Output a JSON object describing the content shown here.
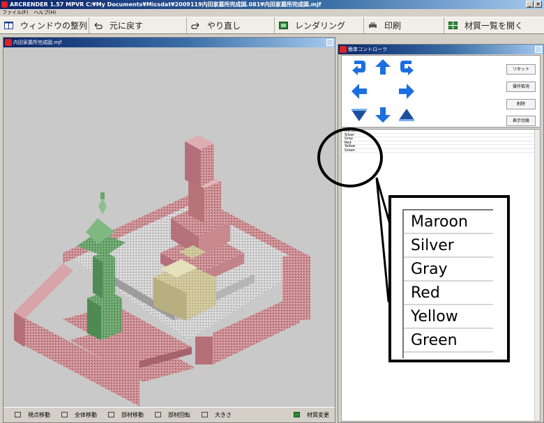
{
  "window": {
    "title": "ARCRENDER 1.57 MPVR  C:¥My Documents¥Micsdat¥2009119内田家墓所完成図.081¥内田家墓所完成図.mjf"
  },
  "menu": [
    "ファイル(F)",
    "ヘルプ(H)"
  ],
  "toolbar": {
    "buttons": [
      {
        "label": "ウィンドウの整列",
        "icon": "window-tile-icon"
      },
      {
        "label": "元に戻す",
        "icon": "undo-icon"
      },
      {
        "label": "やり直し",
        "icon": "redo-icon"
      },
      {
        "label": "レンダリング",
        "icon": "render-icon"
      },
      {
        "label": "印刷",
        "icon": "printer-icon"
      },
      {
        "label": "材質一覧を開く",
        "icon": "material-list-icon"
      }
    ]
  },
  "viewport": {
    "title": "内田家墓所完成図.mjf",
    "status": [
      "視点移動",
      "全体移動",
      "部材移動",
      "部材回転",
      "大きさ",
      "材質変更"
    ]
  },
  "panel": {
    "title": "簡単コントローラ",
    "side_buttons": [
      "リセット",
      "操作取消",
      "削除",
      "表示切換"
    ],
    "list_items": [
      "Maroon",
      "Silver",
      "Gray",
      "Red",
      "Yellow",
      "Green"
    ]
  },
  "callout": {
    "items": [
      "Maroon",
      "Silver",
      "Gray",
      "Red",
      "Yellow",
      "Green"
    ]
  },
  "colors": {
    "arrow_blue": "#1c6fe0",
    "granite_red": "#c98a8f",
    "lantern_green": "#6aa56c"
  }
}
